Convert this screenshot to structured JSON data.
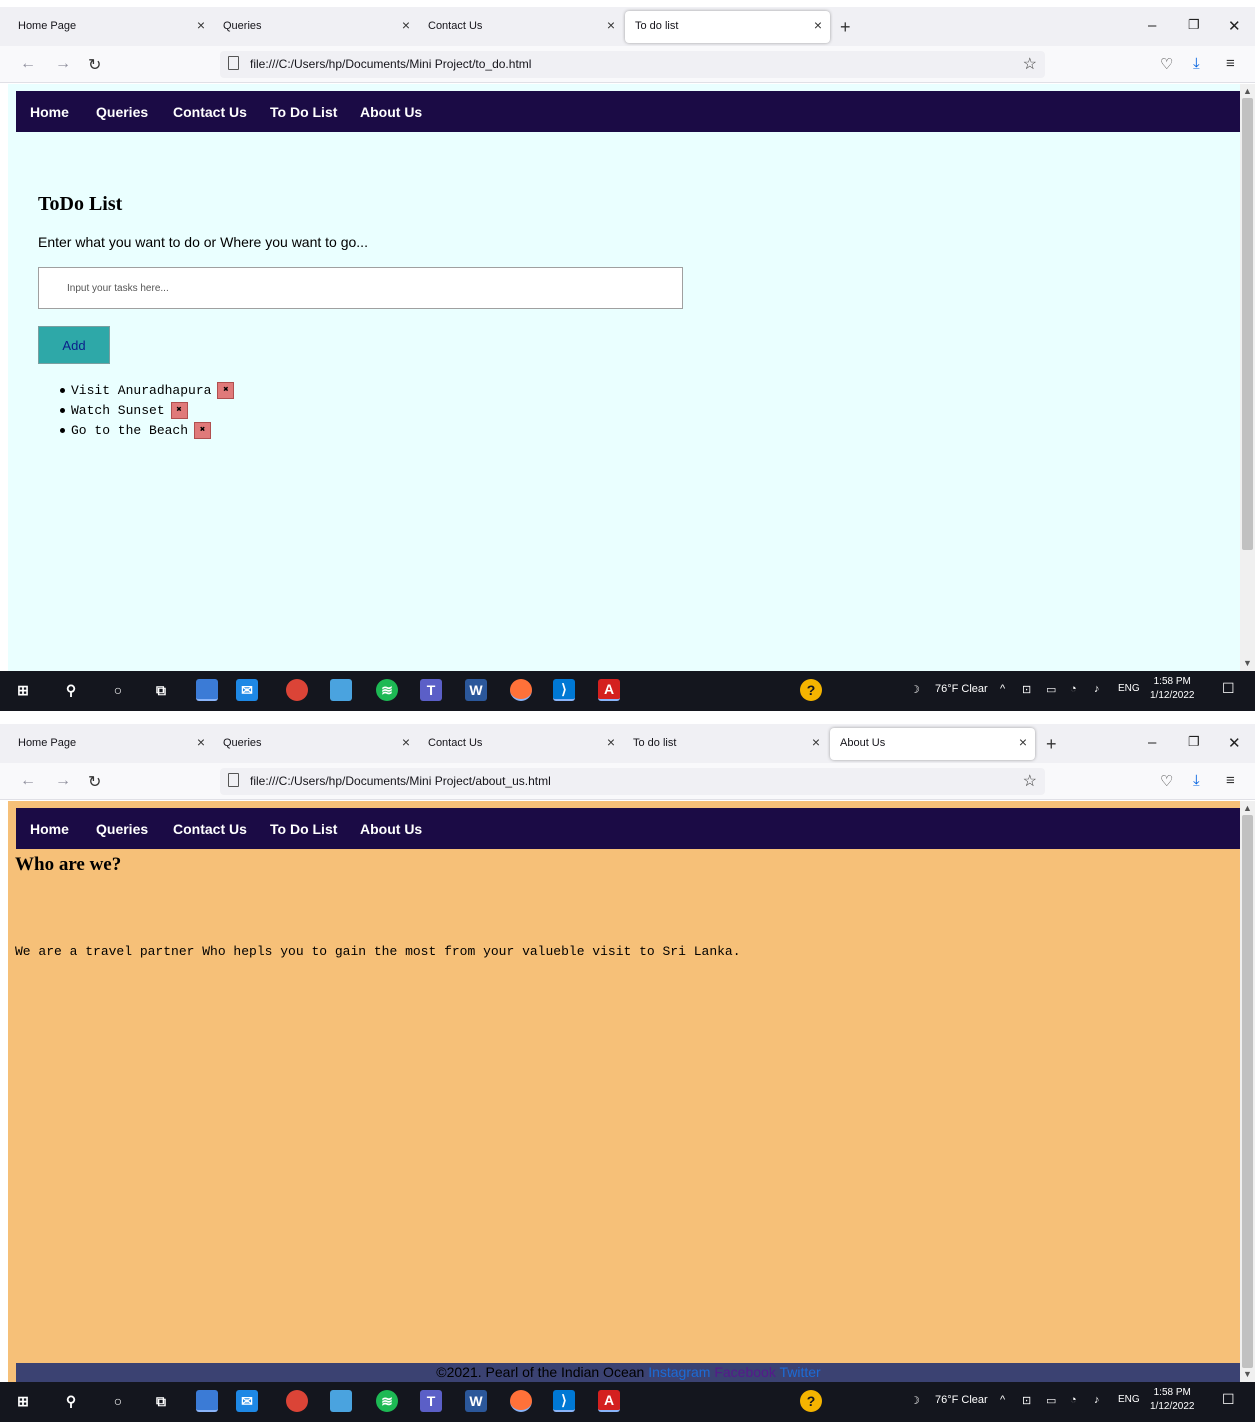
{
  "shots": [
    {
      "tabs": [
        {
          "title": "Home Page",
          "active": false
        },
        {
          "title": "Queries",
          "active": false
        },
        {
          "title": "Contact Us",
          "active": false
        },
        {
          "title": "To do list",
          "active": true
        }
      ],
      "url": "file:///C:/Users/hp/Documents/Mini Project/to_do.html"
    },
    {
      "tabs": [
        {
          "title": "Home Page",
          "active": false
        },
        {
          "title": "Queries",
          "active": false
        },
        {
          "title": "Contact Us",
          "active": false
        },
        {
          "title": "To do list",
          "active": false
        },
        {
          "title": "About Us",
          "active": true
        }
      ],
      "url": "file:///C:/Users/hp/Documents/Mini Project/about_us.html"
    }
  ],
  "site_nav": [
    "Home",
    "Queries",
    "Contact Us",
    "To Do List",
    "About Us"
  ],
  "todo": {
    "title": "ToDo List",
    "description": "Enter what you want to do or Where you want to go...",
    "input_placeholder": "Input your tasks here...",
    "add_label": "Add",
    "delete_glyph": "✖",
    "items": [
      "Visit Anuradhapura",
      "Watch Sunset",
      "Go to the Beach"
    ]
  },
  "about": {
    "title": "Who are we?",
    "text": "We are a travel partner Who hepls you to gain the most from your valueble visit to Sri Lanka.",
    "footer_copyright": "©2021. Pearl of the Indian Ocean",
    "footer_links": [
      "Instagram",
      "Facebook",
      "Twitter"
    ]
  },
  "taskbar": {
    "weather": "76°F Clear",
    "language": "ENG",
    "time": "1:58 PM",
    "date": "1/12/2022"
  },
  "colors": {
    "site_nav_bg": "#1b0b45",
    "todo_bg": "#eaffff",
    "about_bg": "#f6c078",
    "add_button": "#2ea8a8",
    "delete_button": "#e07a7a",
    "footer_bg": "#3b4272",
    "footer_instagram": "#1c6bd6",
    "footer_facebook": "#551a8b",
    "footer_twitter": "#1c6bd6"
  },
  "icons": {
    "close": "close-icon",
    "new_tab": "plus-icon",
    "back": "arrow-left-icon",
    "forward": "arrow-right-icon",
    "reload": "reload-icon",
    "page": "page-icon",
    "bookmark": "star-icon",
    "pocket": "pocket-icon",
    "download": "download-icon",
    "menu": "hamburger-icon"
  }
}
